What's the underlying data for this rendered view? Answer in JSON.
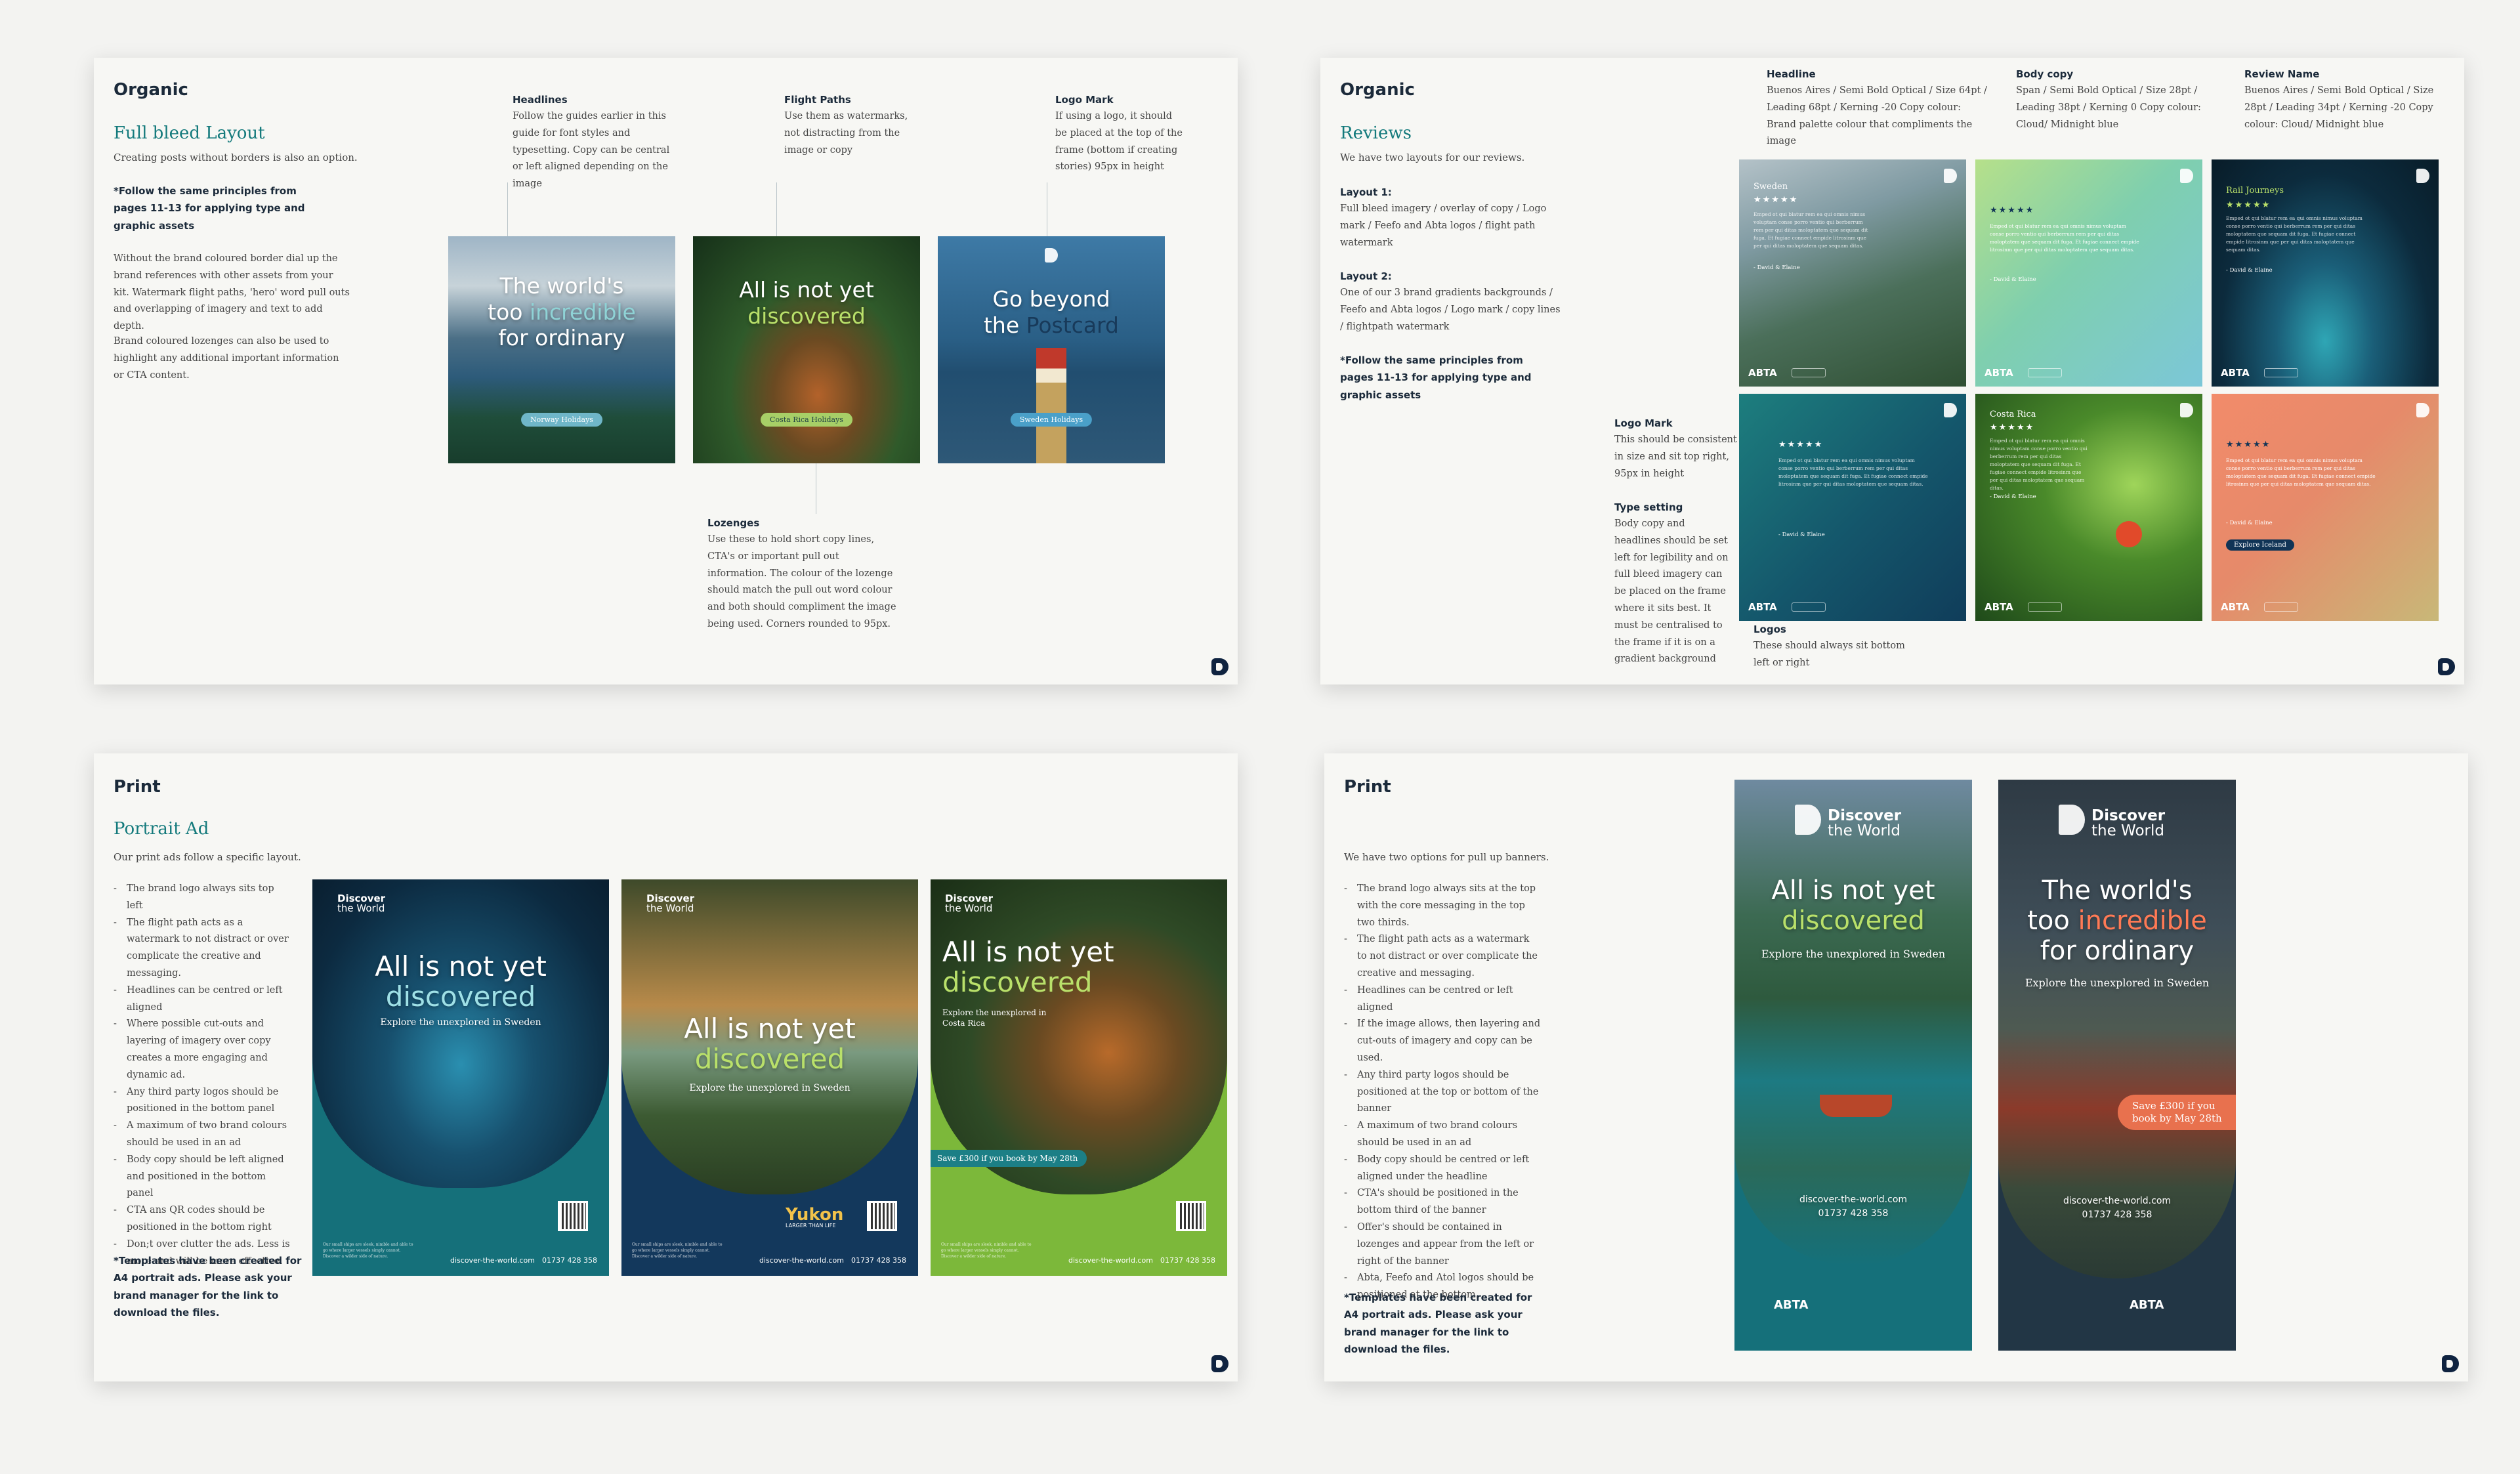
{
  "organic_full_bleed": {
    "section": "Organic",
    "title": "Full bleed Layout",
    "intro": "Creating posts without borders is also an option.",
    "note": "*Follow the same principles from pages 11-13 for applying type and graphic assets",
    "para1": "Without the brand coloured border dial up the brand references with other assets from your kit. Watermark flight paths, 'hero' word pull outs and overlapping of imagery and text to add depth.",
    "para2": "Brand coloured lozenges can also be used to highlight any additional important information or CTA content.",
    "headlines": {
      "label": "Headlines",
      "text": "Follow the guides earlier in this guide for font styles and typesetting. Copy can be central or left aligned depending on the image"
    },
    "flight_paths": {
      "label": "Flight Paths",
      "text": "Use them as watermarks, not distracting from the image or copy"
    },
    "logo_mark": {
      "label": "Logo Mark",
      "text": "If using a logo, it should be placed at the top of the frame (bottom if creating stories) 95px in height"
    },
    "lozenges": {
      "label": "Lozenges",
      "text": "Use these to hold short copy lines, CTA's or important pull out information. The colour of the lozenge should match the pull out word colour and both should compliment the image being used. Corners rounded to 95px."
    },
    "tiles": [
      {
        "l1": "The world's",
        "l2a": "too ",
        "l2b": "incredible",
        "l3": "for ordinary",
        "lozenge": "Norway Holidays"
      },
      {
        "l1": "All is not yet",
        "l2": "discovered",
        "lozenge": "Costa Rica Holidays"
      },
      {
        "l1": "Go beyond",
        "l2a": "the ",
        "l2b": "Postcard",
        "lozenge": "Sweden Holidays"
      }
    ]
  },
  "organic_reviews": {
    "section": "Organic",
    "title": "Reviews",
    "intro": "We have two layouts for our reviews.",
    "layout1_label": "Layout 1:",
    "layout1_text": "Full bleed imagery / overlay of copy / Logo mark / Feefo and Abta logos / flight path watermark",
    "layout2_label": "Layout 2:",
    "layout2_text": "One of our 3 brand gradients backgrounds / Feefo and Abta logos / Logo mark / copy lines / flightpath watermark",
    "note": "*Follow the same principles from pages 11-13 for applying type and graphic assets",
    "headline_spec": {
      "label": "Headline",
      "text": "Buenos Aires / Semi Bold Optical / Size 64pt / Leading 68pt / Kerning -20 Copy colour: Brand palette colour that compliments the image"
    },
    "body_spec": {
      "label": "Body copy",
      "text": "Span / Semi Bold Optical / Size 28pt / Leading 38pt / Kerning 0 Copy colour: Cloud/ Midnight blue"
    },
    "review_name_spec": {
      "label": "Review Name",
      "text": "Buenos Aires / Semi Bold Optical / Size 28pt / Leading 34pt / Kerning -20 Copy colour: Cloud/ Midnight blue"
    },
    "logo_mark": {
      "label": "Logo Mark",
      "text": "This should be consistent in size and sit top right, 95px in height"
    },
    "type_setting": {
      "label": "Type setting",
      "text": "Body copy and headlines should be set left for legibility and on full bleed imagery can be placed on the frame where it sits best. It must be centralised to the frame if it is on a gradient background"
    },
    "logos": {
      "label": "Logos",
      "text": "These should always sit bottom left or right"
    },
    "review_text": "Emped ot qui blatur rem ea qui omnis nimus voluptam conse porro ventio qui berberrum rem per qui ditas moloptatem que sequam dit fuga. Et fugiae connect empide litrosinm que per qui ditas moloptatem que sequam ditas.",
    "signature": "- David & Elaine",
    "stars": "★★★★★",
    "abta": "ABTA",
    "cards": [
      {
        "city": "Sweden"
      },
      {
        "city": ""
      },
      {
        "city": "Rail Journeys"
      },
      {
        "city": ""
      },
      {
        "city": "Costa Rica"
      },
      {
        "city": "",
        "cta": "Explore Iceland"
      }
    ]
  },
  "print_portrait": {
    "section": "Print",
    "title": "Portrait Ad",
    "intro": "Our print ads follow a specific layout.",
    "bullets": [
      "The brand logo always sits top left",
      "The flight path acts as a watermark to not distract or over complicate the creative and messaging.",
      "Headlines can be centred or left aligned",
      "Where possible cut-outs and layering of imagery over copy creates a more engaging and dynamic ad.",
      "Any third party logos should be positioned in the bottom panel",
      "A maximum of two brand colours should be used in an ad",
      "Body copy should be left aligned and positioned in the bottom panel",
      "CTA ans QR codes should be positioned in the bottom right",
      "Don;t over clutter the ads. Less is more and will be more effective."
    ],
    "note": "*Templates have been created for A4 portrait ads. Please ask your brand manager for the link to download the files.",
    "brand_line1": "Discover",
    "brand_line2": "the World",
    "url": "discover-the-world.com",
    "phone": "01737 428 358",
    "fine_print": "Our small ships are sleek, nimble and able to go where larger vessels simply cannot. Discover a wilder side of nature.",
    "ads": [
      {
        "l1": "All is not yet",
        "l2": "discovered",
        "sub": "Explore the unexplored in Sweden"
      },
      {
        "l1": "All is not yet",
        "l2": "discovered",
        "sub": "Explore the unexplored in Sweden",
        "partner": "Yukon",
        "partner_sub": "LARGER THAN LIFE"
      },
      {
        "l1": "All is not yet",
        "l2": "discovered",
        "sub": "Explore the unexplored in Costa Rica",
        "offer": "Save £300 if you book by May 28th"
      }
    ]
  },
  "print_banners": {
    "section": "Print",
    "intro": "We have two options for pull up banners.",
    "bullets": [
      "The brand logo always sits at the top with the core messaging in the top two thirds.",
      "The flight path acts as a watermark to not distract or over complicate the creative and messaging.",
      "Headlines can be centred or left aligned",
      "If the image allows, then layering and cut-outs of imagery and copy can be used.",
      "Any third party logos should be positioned at the top or bottom of the banner",
      "A maximum of two brand colours should be used in an ad",
      "Body copy should be centred or left aligned under the headline",
      "CTA's should be positioned in the bottom third of the banner",
      "Offer's should be contained in lozenges and appear from the left or right of the banner",
      "Abta, Feefo and Atol logos should be positioned at the bottom."
    ],
    "note": "*Templates have been created for A4 portrait ads. Please ask your brand manager for the link to download the files.",
    "banner1": {
      "l1": "All is not yet",
      "l2": "discovered",
      "sub": "Explore the unexplored in Sweden"
    },
    "banner2": {
      "l1": "The world's",
      "l2a": "too ",
      "l2b": "incredible",
      "l3": "for ordinary",
      "sub": "Explore the unexplored in Sweden",
      "offer": "Save £300 if you book by May 28th"
    }
  }
}
